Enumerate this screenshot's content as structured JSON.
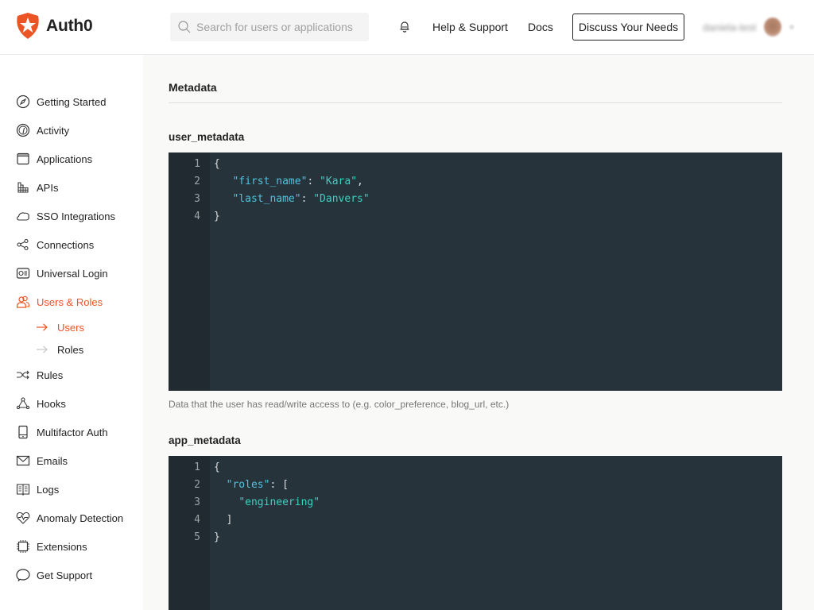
{
  "header": {
    "brand": "Auth0",
    "search_placeholder": "Search for users or applications",
    "search_value": "",
    "help_link": "Help & Support",
    "docs_link": "Docs",
    "discuss_button": "Discuss Your Needs",
    "user_name": "daniela-test",
    "accent_color": "#eb5424"
  },
  "sidebar": {
    "items": [
      {
        "label": "Getting Started",
        "icon": "compass-icon"
      },
      {
        "label": "Activity",
        "icon": "gauge-icon"
      },
      {
        "label": "Applications",
        "icon": "window-icon"
      },
      {
        "label": "APIs",
        "icon": "grid-icon"
      },
      {
        "label": "SSO Integrations",
        "icon": "cloud-icon"
      },
      {
        "label": "Connections",
        "icon": "share-nodes-icon"
      },
      {
        "label": "Universal Login",
        "icon": "login-card-icon"
      },
      {
        "label": "Users & Roles",
        "icon": "users-icon",
        "active": true
      },
      {
        "label": "Rules",
        "icon": "shuffle-icon"
      },
      {
        "label": "Hooks",
        "icon": "hooks-icon"
      },
      {
        "label": "Multifactor Auth",
        "icon": "mobile-icon"
      },
      {
        "label": "Emails",
        "icon": "envelope-icon"
      },
      {
        "label": "Logs",
        "icon": "book-icon"
      },
      {
        "label": "Anomaly Detection",
        "icon": "heartbeat-icon"
      },
      {
        "label": "Extensions",
        "icon": "chip-icon"
      },
      {
        "label": "Get Support",
        "icon": "chat-bubble-icon"
      }
    ],
    "subitems": [
      {
        "label": "Users",
        "active": true
      },
      {
        "label": "Roles",
        "active": false
      }
    ]
  },
  "main": {
    "section_title": "Metadata",
    "user_metadata": {
      "label": "user_metadata",
      "line_numbers": [
        "1",
        "2",
        "3",
        "4"
      ],
      "help": "Data that the user has read/write access to (e.g. color_preference, blog_url, etc.)",
      "code": {
        "open": "{",
        "k1": "\"first_name\"",
        "v1": "\"Kara\"",
        "k2": "\"last_name\"",
        "v2": "\"Danvers\"",
        "close": "}"
      }
    },
    "app_metadata": {
      "label": "app_metadata",
      "line_numbers": [
        "1",
        "2",
        "3",
        "4",
        "5"
      ],
      "code": {
        "open": "{",
        "k1": "\"roles\"",
        "v1": "\"engineering\"",
        "arr_open": "[",
        "arr_close": "]",
        "close": "}"
      }
    }
  }
}
